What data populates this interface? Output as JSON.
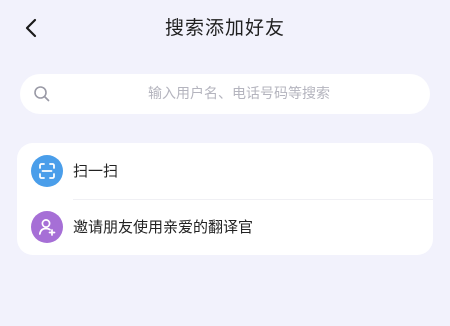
{
  "header": {
    "title": "搜索添加好友",
    "back_icon": "chevron-left-icon"
  },
  "search": {
    "placeholder": "输入用户名、电话号码等搜索",
    "value": "",
    "icon": "search-icon"
  },
  "menu": {
    "items": [
      {
        "label": "扫一扫",
        "icon": "scan-icon",
        "color": "#4A9EEA"
      },
      {
        "label": "邀请朋友使用亲爱的翻译官",
        "icon": "add-user-icon",
        "color": "#A66FD6"
      }
    ]
  },
  "theme": {
    "background": "#F2F2FC",
    "card": "#FFFFFF"
  }
}
